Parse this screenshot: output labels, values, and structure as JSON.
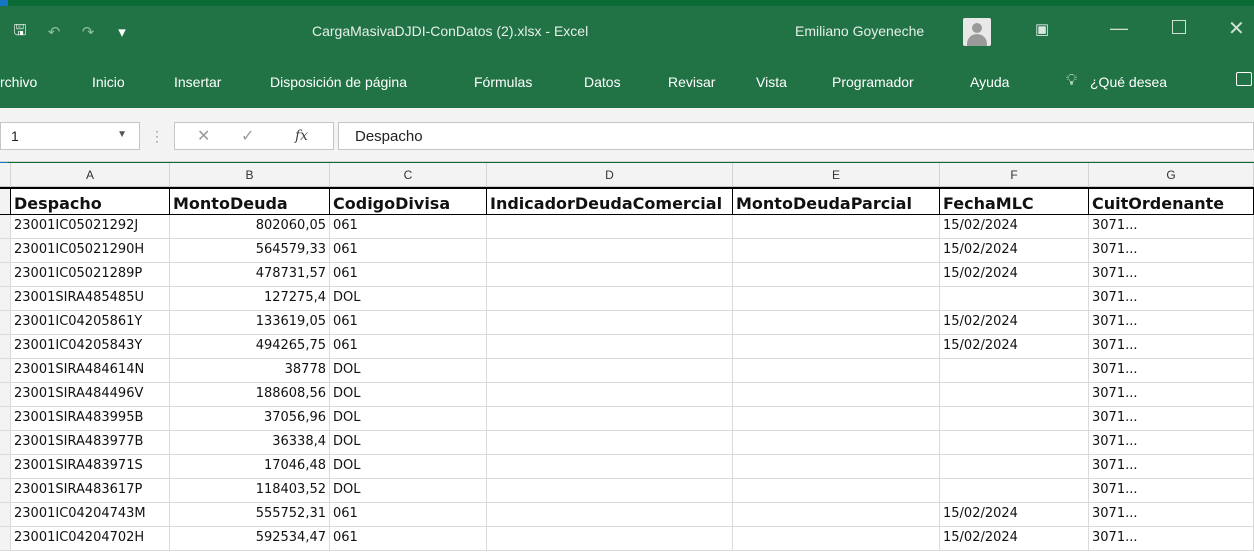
{
  "titlebar": {
    "document_title": "CargaMasivaDJDI-ConDatos (2).xlsx  -  Excel",
    "user_name": "Emiliano Goyeneche"
  },
  "ribbon": {
    "tabs": [
      "rchivo",
      "Inicio",
      "Insertar",
      "Disposición de página",
      "Fórmulas",
      "Datos",
      "Revisar",
      "Vista",
      "Programador",
      "Ayuda"
    ],
    "tell_me": "¿Qué desea"
  },
  "formula_bar": {
    "name_box": "1",
    "content": "Despacho"
  },
  "grid": {
    "column_letters": [
      "A",
      "B",
      "C",
      "D",
      "E",
      "F",
      "G"
    ],
    "headers": [
      "Despacho",
      "MontoDeuda",
      "CodigoDivisa",
      "IndicadorDeudaComercial",
      "MontoDeudaParcial",
      "FechaMLC",
      "CuitOrdenante"
    ],
    "rows": [
      [
        "23001IC05021292J",
        "802060,05",
        "061",
        "",
        "",
        "15/02/2024",
        "3071..."
      ],
      [
        "23001IC05021290H",
        "564579,33",
        "061",
        "",
        "",
        "15/02/2024",
        "3071..."
      ],
      [
        "23001IC05021289P",
        "478731,57",
        "061",
        "",
        "",
        "15/02/2024",
        "3071..."
      ],
      [
        "23001SIRA485485U",
        "127275,4",
        "DOL",
        "",
        "",
        "",
        "3071..."
      ],
      [
        "23001IC04205861Y",
        "133619,05",
        "061",
        "",
        "",
        "15/02/2024",
        "3071..."
      ],
      [
        "23001IC04205843Y",
        "494265,75",
        "061",
        "",
        "",
        "15/02/2024",
        "3071..."
      ],
      [
        "23001SIRA484614N",
        "38778",
        "DOL",
        "",
        "",
        "",
        "3071..."
      ],
      [
        "23001SIRA484496V",
        "188608,56",
        "DOL",
        "",
        "",
        "",
        "3071..."
      ],
      [
        "23001SIRA483995B",
        "37056,96",
        "DOL",
        "",
        "",
        "",
        "3071..."
      ],
      [
        "23001SIRA483977B",
        "36338,4",
        "DOL",
        "",
        "",
        "",
        "3071..."
      ],
      [
        "23001SIRA483971S",
        "17046,48",
        "DOL",
        "",
        "",
        "",
        "3071..."
      ],
      [
        "23001SIRA483617P",
        "118403,52",
        "DOL",
        "",
        "",
        "",
        "3071..."
      ],
      [
        "23001IC04204743M",
        "555752,31",
        "061",
        "",
        "",
        "15/02/2024",
        "3071..."
      ],
      [
        "23001IC04204702H",
        "592534,47",
        "061",
        "",
        "",
        "15/02/2024",
        "3071..."
      ]
    ]
  },
  "colors": {
    "excel_green": "#217346",
    "accent_blue": "#1377c6"
  }
}
